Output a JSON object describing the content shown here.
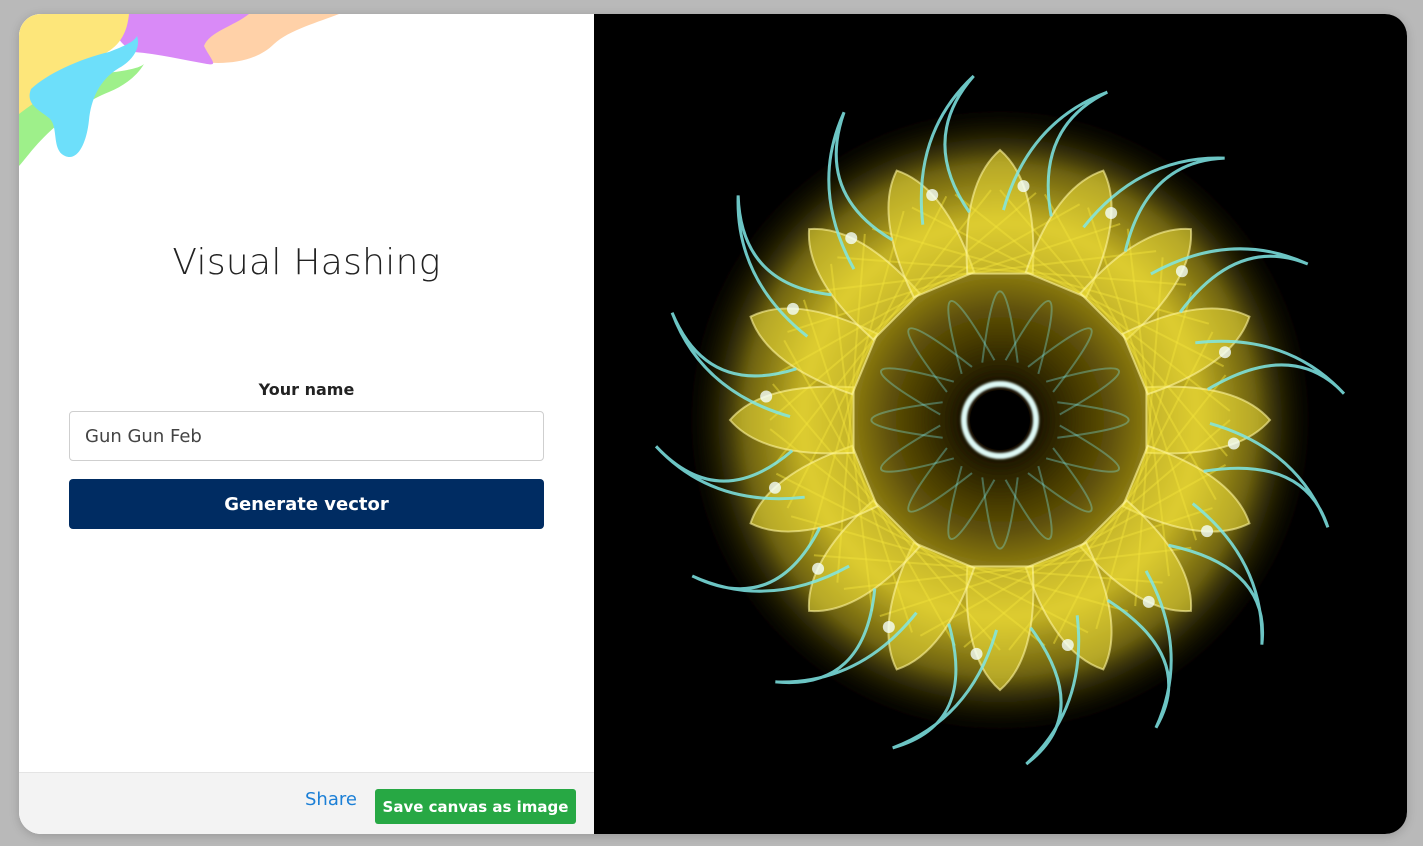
{
  "app": {
    "title": "Visual Hashing"
  },
  "form": {
    "name_label": "Your name",
    "name_value": "Gun Gun Feb",
    "generate_label": "Generate vector"
  },
  "footer": {
    "share_label": "Share",
    "save_label": "Save canvas as image"
  },
  "colors": {
    "page_background": "#b9b9b9",
    "primary_button": "#002c62",
    "success_button": "#27a844",
    "link": "#1b7fd6",
    "canvas_background": "#000000",
    "mandala_yellow": "#f2e23a",
    "mandala_cyan": "#7fe7e6"
  },
  "decoration": {
    "blob_colors": [
      "#fde67a",
      "#d98af7",
      "#ffd1a8",
      "#6ddffa",
      "#9ef08a"
    ]
  }
}
